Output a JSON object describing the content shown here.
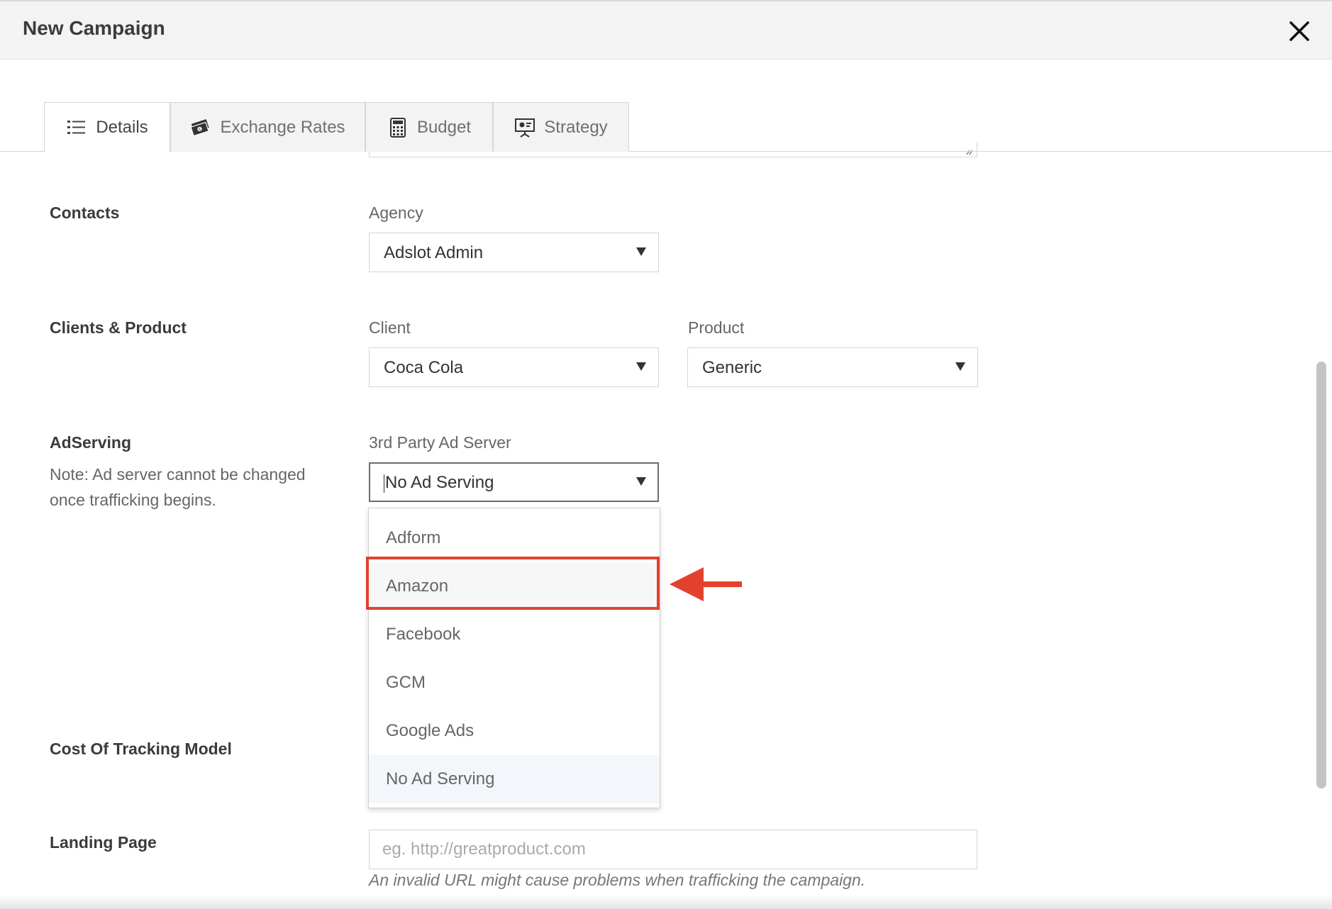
{
  "modal": {
    "title": "New Campaign"
  },
  "tabs": [
    {
      "label": "Details",
      "icon": "list-icon"
    },
    {
      "label": "Exchange Rates",
      "icon": "money-icon"
    },
    {
      "label": "Budget",
      "icon": "calculator-icon"
    },
    {
      "label": "Strategy",
      "icon": "presentation-icon"
    }
  ],
  "sections": {
    "contacts": {
      "title": "Contacts",
      "agency_label": "Agency",
      "agency_value": "Adslot Admin"
    },
    "clients_product": {
      "title": "Clients & Product",
      "client_label": "Client",
      "client_value": "Coca Cola",
      "product_label": "Product",
      "product_value": "Generic"
    },
    "adserving": {
      "title": "AdServing",
      "note": "Note: Ad server cannot be changed once trafficking begins.",
      "server_label": "3rd Party Ad Server",
      "server_value": "No Ad Serving",
      "options": [
        "Adform",
        "Amazon",
        "Facebook",
        "GCM",
        "Google Ads",
        "No Ad Serving"
      ]
    },
    "cost_tracking": {
      "title": "Cost Of Tracking Model"
    },
    "landing_page": {
      "title": "Landing Page",
      "placeholder": "eg. http://greatproduct.com",
      "help": "An invalid URL might cause problems when trafficking the campaign."
    }
  },
  "colors": {
    "annotation_red": "#e2422d",
    "header_bg": "#f3f3f3"
  }
}
